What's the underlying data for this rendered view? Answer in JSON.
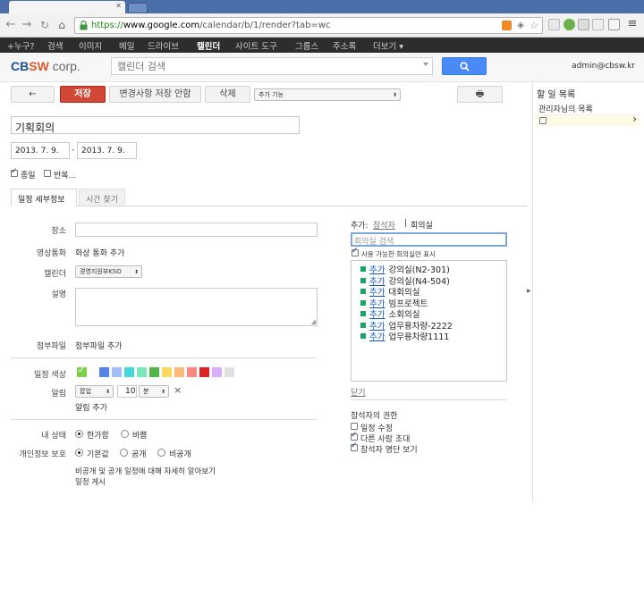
{
  "browser": {
    "url_scheme": "https://",
    "url_host": "www.google.com",
    "url_path": "/calendar/b/1/render?tab=wc"
  },
  "gbar": {
    "items": [
      "+누구?",
      "검색",
      "이미지",
      "메일",
      "드라이브",
      "캘린더",
      "사이트 도구",
      "그룹스",
      "주소록",
      "더보기 ▾"
    ],
    "active_index": 5
  },
  "header": {
    "logo_c": "C",
    "logo_b": "B",
    "logo_sw": "SW",
    "logo_corp": " corp.",
    "search_placeholder": "캘린더 검색",
    "user_email": "admin@cbsw.kr"
  },
  "actions": {
    "back": "←",
    "save": "저장",
    "discard": "변경사항 저장 안함",
    "delete": "삭제",
    "more_actions": "추가 기능",
    "print": "🖶"
  },
  "event": {
    "title": "기획회의",
    "start_date": "2013. 7. 9.",
    "date_sep": "-",
    "end_date": "2013. 7. 9.",
    "all_day_label": "종일",
    "repeat_label": "반복..."
  },
  "tabs": {
    "details": "일정 세부정보",
    "find_time": "시간 찾기"
  },
  "form": {
    "where_label": "장소",
    "video_label": "영상통화",
    "video_link": "화상 통화 추가",
    "calendar_label": "캘린더",
    "calendar_value": "경영지원부KSO",
    "description_label": "설명",
    "attachment_label": "첨부파일",
    "attachment_link": "첨부파일 추가",
    "color_label": "일정 색상",
    "reminder_label": "알림",
    "reminder_type": "팝업",
    "reminder_num": "10",
    "reminder_unit": "분",
    "reminder_remove": "×",
    "add_reminder": "알림 추가",
    "status_label": "내 상태",
    "status_free": "한가함",
    "status_busy": "바쁨",
    "privacy_label": "개인정보 보호",
    "privacy_default": "기본값",
    "privacy_public": "공개",
    "privacy_private": "비공개",
    "privacy_link1": "비공개 및 공개 일정에 대해 자세히 알아보기",
    "privacy_link2": "일정 게시"
  },
  "colors": [
    "#7bd148",
    "#5484ed",
    "#a4bdfc",
    "#46d6db",
    "#7ae7bf",
    "#51b749",
    "#fbd75b",
    "#ffb878",
    "#ff887c",
    "#dc2127",
    "#dbadff",
    "#e1e1e1"
  ],
  "rooms": {
    "add_label": "추가:",
    "guests_tab": "참석자",
    "sep": "|",
    "rooms_tab": "회의실",
    "search_placeholder": "회의실 검색",
    "available_only": "사용 가능한 회의실만 표시",
    "add_link": "추가",
    "list": [
      "강의실(N2-301)",
      "강의실(N4-504)",
      "대회의실",
      "빔프로젝트",
      "소회의실",
      "업무용차량-2222",
      "업무용차량1111"
    ],
    "close": "닫기"
  },
  "permissions": {
    "title": "참석자의 권한",
    "items": [
      {
        "label": "일정 수정",
        "checked": false
      },
      {
        "label": "다른 사람 초대",
        "checked": true
      },
      {
        "label": "참석자 명단 보기",
        "checked": true
      }
    ]
  },
  "tasks": {
    "title": "할 일 목록",
    "list_name": "관리자님의 목록",
    "arrow": "›"
  }
}
